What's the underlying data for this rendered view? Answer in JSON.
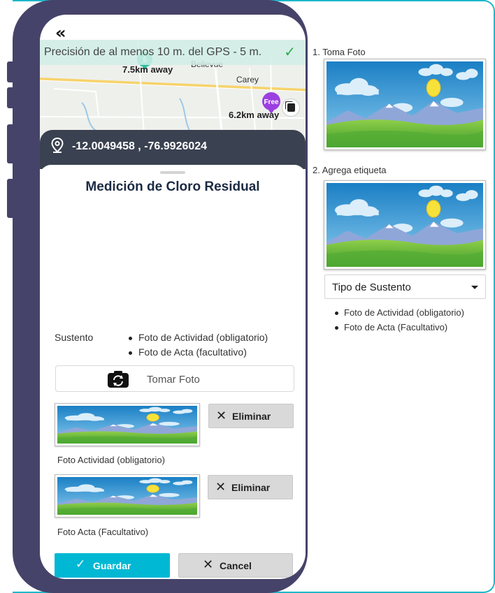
{
  "app": {
    "back_icon": "double-chevron-left-icon",
    "gps_banner": "Precisión de al menos 10 m. del GPS - 5 m.",
    "gps_status_icon": "check-icon",
    "map": {
      "labels": [
        "Bellevue",
        "Carey"
      ],
      "markers": [
        {
          "icon": "dollar-pin-icon",
          "distance": "7.5km away",
          "color": "#2bbfa0"
        },
        {
          "label": "Free",
          "distance": "6.2km away",
          "color": "#9c3fe0"
        }
      ],
      "layers_icon": "layers-icon"
    },
    "coordinates": "-12.0049458 , -76.9926024",
    "coordinates_icon": "location-pin-icon"
  },
  "form": {
    "title": "Medición de Cloro Residual",
    "sustento_label": "Sustento",
    "sustento_items": [
      "Foto de Actividad (obligatorio)",
      "Foto de Acta (facultativo)"
    ],
    "take_photo_label": "Tomar Foto",
    "take_photo_icon": "camera-rotate-icon",
    "photos": [
      {
        "caption": "Foto Actividad (obligatorio)",
        "delete_label": "Eliminar"
      },
      {
        "caption": "Foto Acta (Facultativo)",
        "delete_label": "Eliminar"
      }
    ],
    "save_label": "Guardar",
    "cancel_label": "Cancel"
  },
  "guide": {
    "step1": "1. Toma Foto",
    "step2": "2. Agrega etiqueta",
    "select_value": "Tipo de Sustento",
    "items": [
      "Foto de Actividad (obligatorio)",
      "Foto de Acta (Facultativo)"
    ]
  },
  "colors": {
    "accent": "#00b8d4",
    "phone_frame": "#46436a",
    "coords_bar": "#3a4150",
    "title": "#1c2b45",
    "border": "#1fb8c9"
  }
}
